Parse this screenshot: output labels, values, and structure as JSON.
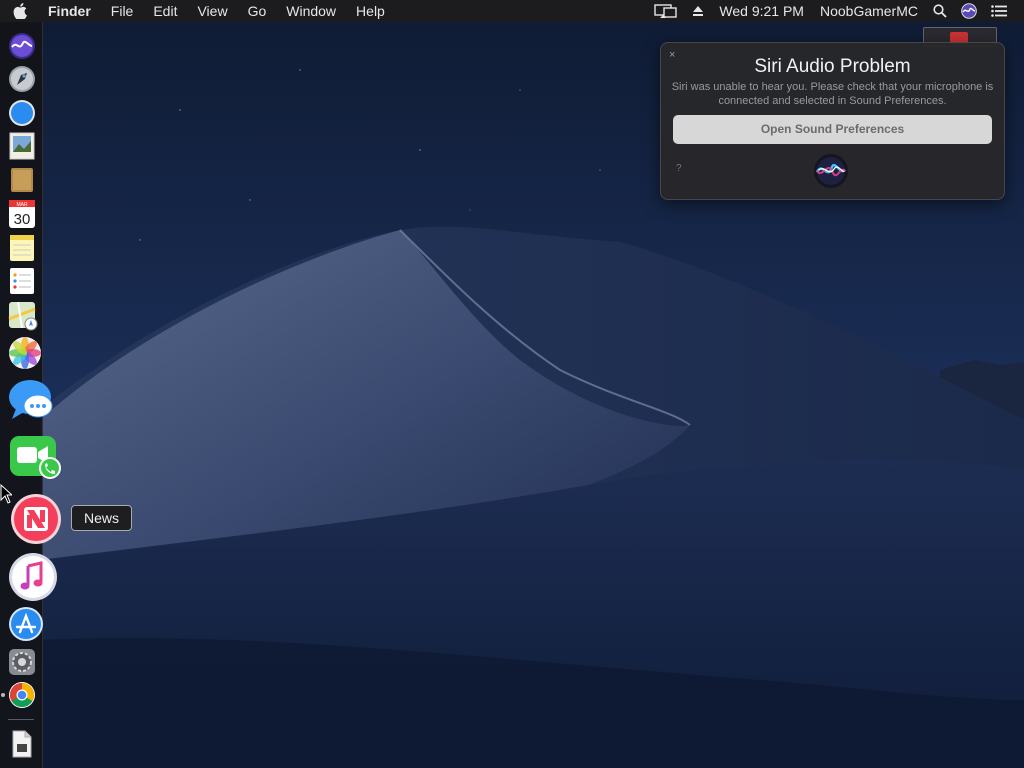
{
  "menubar": {
    "app_name": "Finder",
    "menus": [
      "File",
      "Edit",
      "View",
      "Go",
      "Window",
      "Help"
    ],
    "clock": "Wed 9:21 PM",
    "user": "NoobGamerMC"
  },
  "dock": {
    "tooltip": "News",
    "calendar_day": "30",
    "calendar_month": "MAR"
  },
  "siri": {
    "title": "Siri Audio Problem",
    "message": "Siri was unable to hear you. Please check that your microphone is connected and selected in Sound Preferences.",
    "button_label": "Open Sound Preferences",
    "close_glyph": "×",
    "help_glyph": "?"
  },
  "colors": {
    "menubar_bg": "#1c1c1e",
    "panel_bg": "#28282a",
    "button_bg": "#d7d7d7"
  }
}
